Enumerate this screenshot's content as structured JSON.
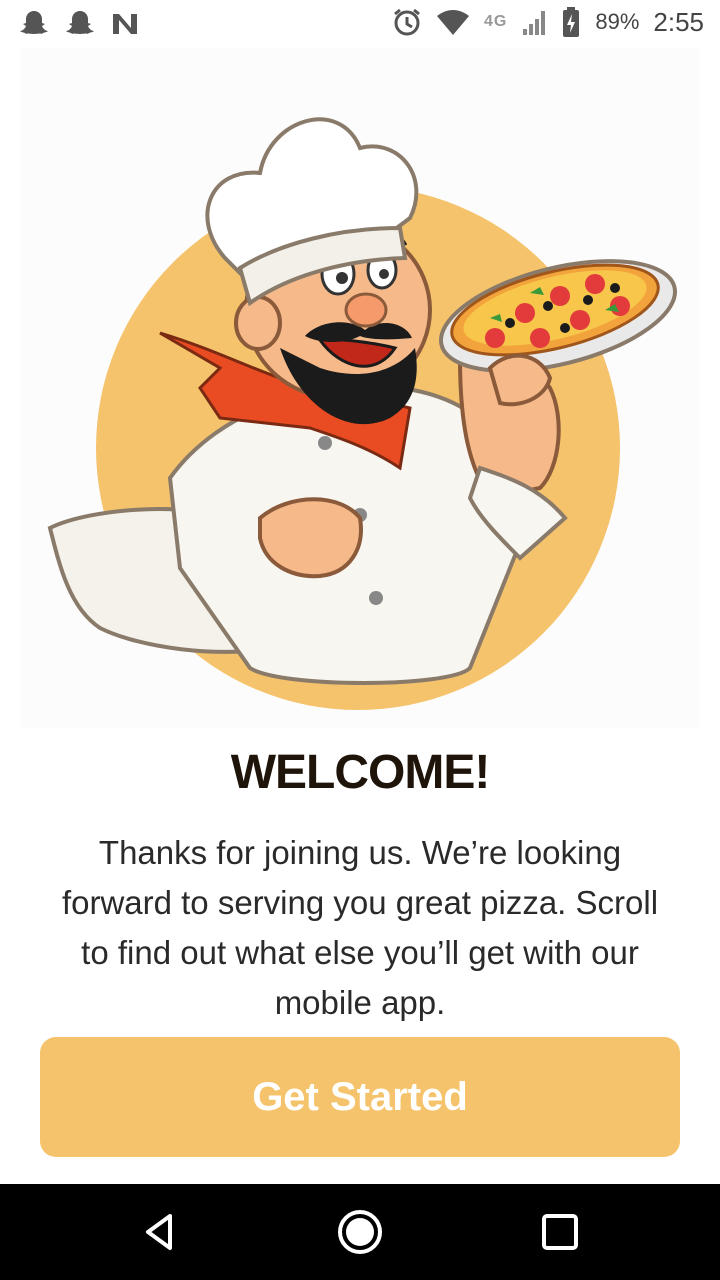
{
  "status_bar": {
    "icons_left": [
      "snapchat-icon",
      "snapchat-icon",
      "n-app-icon"
    ],
    "icons_right": [
      "alarm-icon",
      "wifi-icon",
      "lte-icon",
      "signal-icon",
      "battery-charging-icon"
    ],
    "network": "4G",
    "battery": "89%",
    "time": "2:55"
  },
  "hero": {
    "image": "pizza-chef-illustration",
    "accent_color": "#f5c36b"
  },
  "content": {
    "title": "WELCOME!",
    "description": "Thanks for joining us. We’re looking forward to serving you great pizza. Scroll to find out what else you’ll get with our mobile app."
  },
  "cta": {
    "label": "Get Started",
    "color": "#f5c36b"
  },
  "nav_bar": {
    "buttons": [
      "back-icon",
      "home-icon",
      "recents-icon"
    ]
  }
}
